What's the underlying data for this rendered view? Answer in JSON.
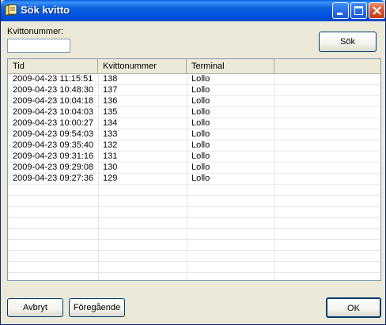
{
  "window": {
    "title": "Sök kvitto",
    "icon": "receipt-app-icon"
  },
  "search": {
    "label": "Kvittonummer:",
    "value": "",
    "button_label": "Sök"
  },
  "table": {
    "columns": [
      "Tid",
      "Kvittonummer",
      "Terminal",
      ""
    ],
    "rows": [
      [
        "2009-04-23 11:15:51",
        "138",
        "Lollo"
      ],
      [
        "2009-04-23 10:48:30",
        "137",
        "Lollo"
      ],
      [
        "2009-04-23 10:04:18",
        "136",
        "Lollo"
      ],
      [
        "2009-04-23 10:04:03",
        "135",
        "Lollo"
      ],
      [
        "2009-04-23 10:00:27",
        "134",
        "Lollo"
      ],
      [
        "2009-04-23 09:54:03",
        "133",
        "Lollo"
      ],
      [
        "2009-04-23 09:35:40",
        "132",
        "Lollo"
      ],
      [
        "2009-04-23 09:31:16",
        "131",
        "Lollo"
      ],
      [
        "2009-04-23 09:29:08",
        "130",
        "Lollo"
      ],
      [
        "2009-04-23 09:27:36",
        "129",
        "Lollo"
      ]
    ]
  },
  "footer": {
    "cancel_label": "Avbryt",
    "previous_label": "Föregående",
    "ok_label": "OK"
  },
  "colors": {
    "titlebar": "#0054e3",
    "window_bg": "#ece9d8",
    "close_button": "#d4532c"
  }
}
